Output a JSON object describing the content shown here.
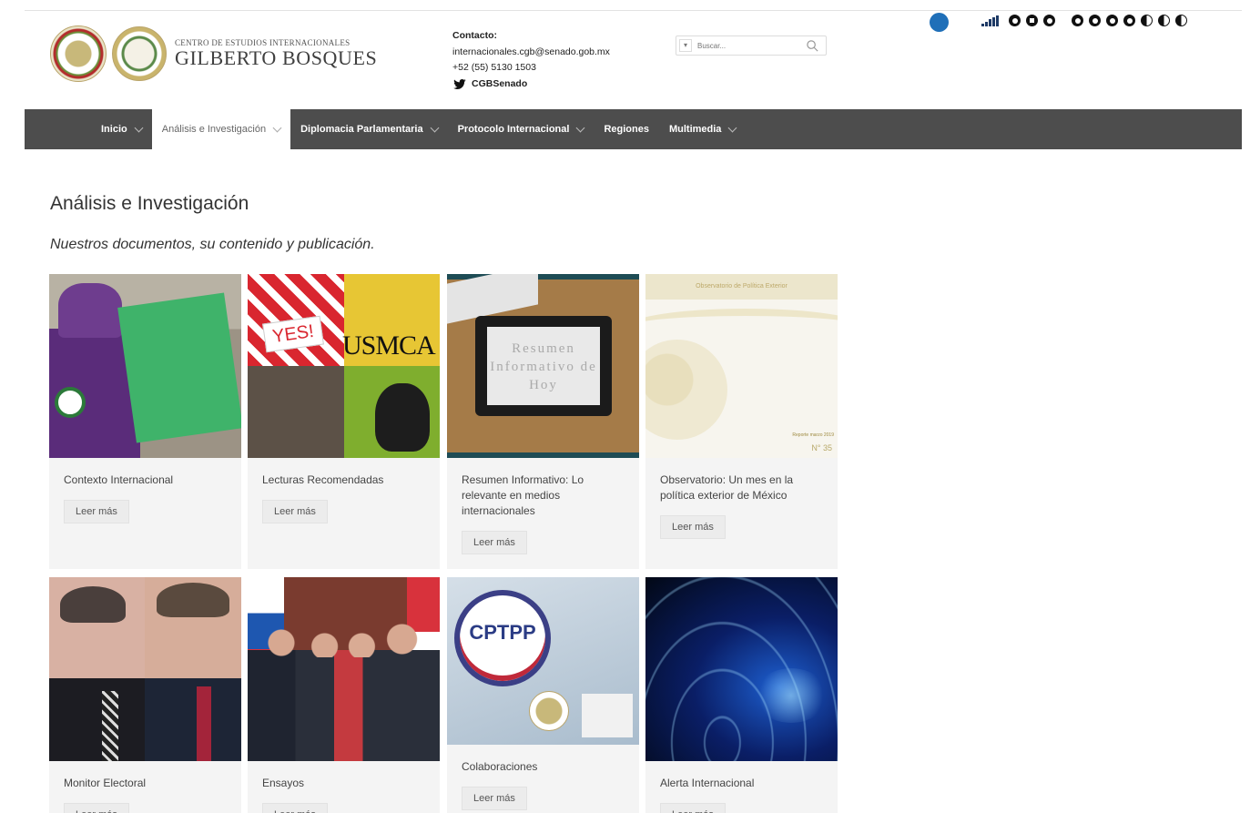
{
  "header": {
    "logo_small": "CENTRO DE ESTUDIOS INTERNACIONALES",
    "logo_big": "GILBERTO BOSQUES",
    "contact_label": "Contacto:",
    "contact_email": "internacionales.cgb@senado.gob.mx",
    "contact_phone": "+52 (55) 5130 1503",
    "twitter_handle": "CGBSenado",
    "search_placeholder": "Buscar..."
  },
  "nav": {
    "items": [
      {
        "label": "Inicio",
        "dropdown": true,
        "active": false
      },
      {
        "label": "Análisis e Investigación",
        "dropdown": true,
        "active": true
      },
      {
        "label": "Diplomacia Parlamentaria",
        "dropdown": true,
        "active": false
      },
      {
        "label": "Protocolo Internacional",
        "dropdown": true,
        "active": false
      },
      {
        "label": "Regiones",
        "dropdown": false,
        "active": false
      },
      {
        "label": "Multimedia",
        "dropdown": true,
        "active": false
      }
    ]
  },
  "main": {
    "title": "Análisis e Investigación",
    "subtitle": "Nuestros documentos, su contenido y publicación.",
    "cards": [
      {
        "title": "Contexto Internacional",
        "button": "Leer más",
        "thumb": "protest-green-sign"
      },
      {
        "title": "Lecturas Recomendadas",
        "button": "Leer más",
        "thumb": "usmca-collage"
      },
      {
        "title": "Resumen Informativo: Lo relevante en medios internacionales",
        "button": "Leer más",
        "thumb": "tablet-on-desk"
      },
      {
        "title": "Observatorio: Un mes en la política exterior de México",
        "button": "Leer más",
        "thumb": "report-cover"
      },
      {
        "title": "Monitor Electoral",
        "button": "Leer más",
        "thumb": "two-candidates"
      },
      {
        "title": "Ensayos",
        "button": "Leer más",
        "thumb": "leaders-handshake"
      },
      {
        "title": "Colaboraciones",
        "button": "Leer más",
        "thumb": "cptpp-logo"
      },
      {
        "title": "Alerta Internacional",
        "button": "Leer más",
        "thumb": "world-network-map"
      }
    ],
    "thumb_text": {
      "yes": "YES!",
      "usmca": "USMCA",
      "resumen": "Resumen Informativo de Hoy",
      "obs_header": "Observatorio de Política Exterior",
      "obs_report": "Reporte marzo 2019",
      "obs_number": "N° 35",
      "cptpp": "CPTPP"
    }
  },
  "colors": {
    "nav_bg": "#4d4d4d",
    "card_bg": "#f4f4f4",
    "accent_blue": "#1f6fb8"
  }
}
